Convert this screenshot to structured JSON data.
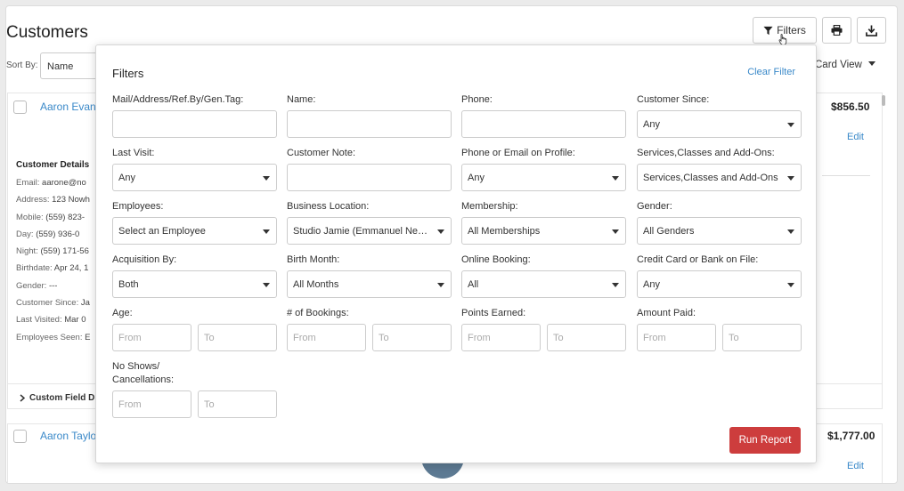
{
  "page": {
    "title": "Customers",
    "sort_by_label": "Sort By:",
    "sort_by_value": "Name",
    "view_label": "Card View"
  },
  "toolbar": {
    "filters_label": "Filters"
  },
  "customers": [
    {
      "name": "Aaron Evan",
      "amount": "$856.50",
      "edit": "Edit",
      "details_title": "Customer Details",
      "details": [
        {
          "k": "Email:",
          "v": "aarone@no"
        },
        {
          "k": "Address:",
          "v": "123 Nowh"
        },
        {
          "k": "Mobile:",
          "v": "(559) 823-"
        },
        {
          "k": "Day:",
          "v": "(559) 936-0"
        },
        {
          "k": "Night:",
          "v": "(559) 171-56"
        },
        {
          "k": "Birthdate:",
          "v": "Apr 24, 1"
        },
        {
          "k": "Gender:",
          "v": "---"
        },
        {
          "k": "Customer Since:",
          "v": "Ja"
        },
        {
          "k": "Last Visited:",
          "v": "Mar 0"
        },
        {
          "k": "Employees Seen:",
          "v": "E"
        }
      ],
      "custom_fields": "Custom Field D"
    },
    {
      "name": "Aaron Taylo",
      "amount": "$1,777.00",
      "edit": "Edit"
    }
  ],
  "filters": {
    "title": "Filters",
    "clear": "Clear Filter",
    "run": "Run Report",
    "fields": {
      "mail": {
        "label": "Mail/Address/Ref.By/Gen.Tag:",
        "value": ""
      },
      "name": {
        "label": "Name:",
        "value": ""
      },
      "phone": {
        "label": "Phone:",
        "value": ""
      },
      "customer_since": {
        "label": "Customer Since:",
        "value": "Any"
      },
      "last_visit": {
        "label": "Last Visit:",
        "value": "Any"
      },
      "customer_note": {
        "label": "Customer Note:",
        "value": ""
      },
      "phone_email_profile": {
        "label": "Phone or Email on Profile:",
        "value": "Any"
      },
      "services": {
        "label": "Services,Classes and Add-Ons:",
        "value": "Services,Classes and Add-Ons"
      },
      "employees": {
        "label": "Employees:",
        "value": "Select an Employee"
      },
      "business_location": {
        "label": "Business Location:",
        "value": "Studio Jamie (Emmanuel Nevar..."
      },
      "membership": {
        "label": "Membership:",
        "value": "All Memberships"
      },
      "gender": {
        "label": "Gender:",
        "value": "All Genders"
      },
      "acquisition_by": {
        "label": "Acquisition By:",
        "value": "Both"
      },
      "birth_month": {
        "label": "Birth Month:",
        "value": "All Months"
      },
      "online_booking": {
        "label": "Online Booking:",
        "value": "All"
      },
      "card_on_file": {
        "label": "Credit Card or Bank on File:",
        "value": "Any"
      },
      "age": {
        "label": "Age:",
        "from": "From",
        "to": "To"
      },
      "bookings": {
        "label": "# of Bookings:",
        "from": "From",
        "to": "To"
      },
      "points": {
        "label": "Points Earned:",
        "from": "From",
        "to": "To"
      },
      "amount_paid": {
        "label": "Amount Paid:",
        "from": "From",
        "to": "To"
      },
      "no_shows": {
        "label_line1": "No Shows/",
        "label_line2": "Cancellations:",
        "from": "From",
        "to": "To"
      }
    }
  },
  "colors": {
    "link": "#3a89c9",
    "run_report": "#cd3d3d"
  },
  "icons": [
    "filter-icon",
    "print-icon",
    "download-icon",
    "pointer-cursor-icon",
    "chevron-down-icon",
    "chevron-right-icon"
  ]
}
